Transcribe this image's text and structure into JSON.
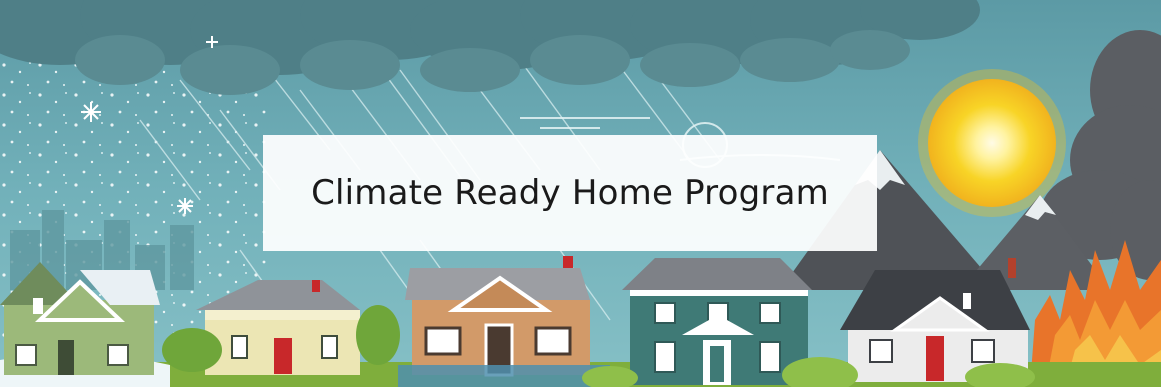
{
  "banner": {
    "title": "Climate Ready Home Program"
  },
  "colors": {
    "sky": "#6aa9b3",
    "storm_cloud": "#4f7f87",
    "smoke": "#5b5e63",
    "sun": "#f7d21e",
    "fire": "#e8742a",
    "grass": "#7fae3c",
    "house_green": "#9cb97a",
    "house_yellow": "#ece6b4",
    "house_tan": "#d29a69",
    "house_teal": "#3f7a76",
    "house_white": "#ececec",
    "door_red": "#c8282a"
  },
  "icons": [
    "snowflake-icon",
    "sun-icon",
    "storm-cloud-icon",
    "fire-icon",
    "rain-streaks-icon",
    "wind-icon"
  ]
}
